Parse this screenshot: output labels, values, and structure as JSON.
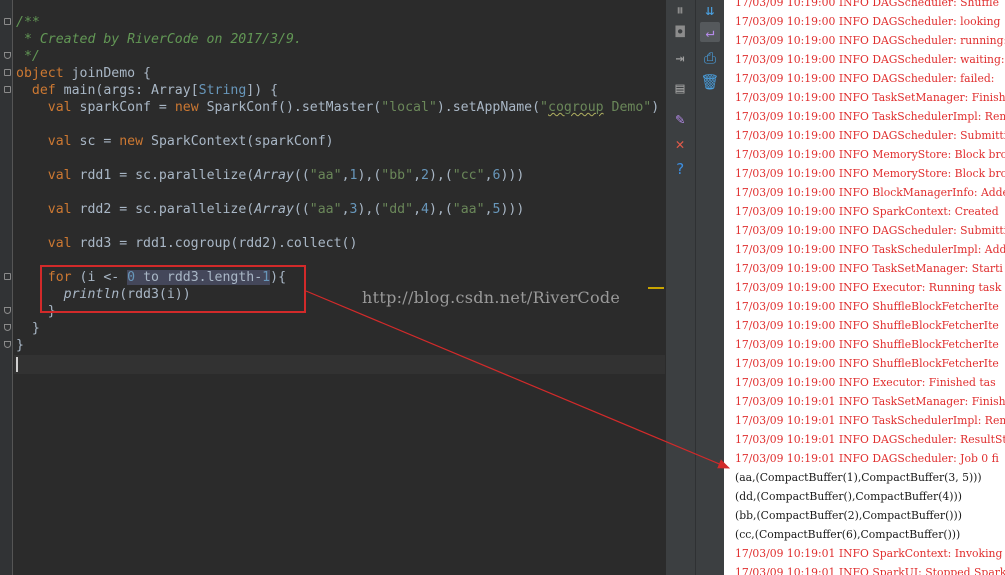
{
  "editor": {
    "lines": [
      [
        {
          "t": "/**",
          "c": "cmt"
        }
      ],
      [
        {
          "t": " * Created by RiverCode on 2017/3/9.",
          "c": "cmt"
        }
      ],
      [
        {
          "t": " */",
          "c": "cmt"
        }
      ],
      [
        {
          "t": "object ",
          "c": "kw"
        },
        {
          "t": "joinDemo {",
          "c": ""
        }
      ],
      [
        {
          "t": "  "
        },
        {
          "t": "def ",
          "c": "kw"
        },
        {
          "t": "main(args: Array["
        },
        {
          "t": "String",
          "c": "num"
        },
        {
          "t": "]) {"
        }
      ],
      [
        {
          "t": "    "
        },
        {
          "t": "val ",
          "c": "kw"
        },
        {
          "t": "sparkConf = "
        },
        {
          "t": "new ",
          "c": "kw"
        },
        {
          "t": "SparkConf().setMaster("
        },
        {
          "t": "\"local\"",
          "c": "str"
        },
        {
          "t": ").setAppName("
        },
        {
          "t": "\"",
          "c": "str"
        },
        {
          "t": "cogroup",
          "c": "str squig"
        },
        {
          "t": " Demo\"",
          "c": "str"
        },
        {
          "t": ")"
        }
      ],
      [
        {
          "t": ""
        }
      ],
      [
        {
          "t": "    "
        },
        {
          "t": "val ",
          "c": "kw"
        },
        {
          "t": "sc = "
        },
        {
          "t": "new ",
          "c": "kw"
        },
        {
          "t": "SparkContext(sparkConf)"
        }
      ],
      [
        {
          "t": ""
        }
      ],
      [
        {
          "t": "    "
        },
        {
          "t": "val ",
          "c": "kw"
        },
        {
          "t": "rdd1 = sc.parallelize("
        },
        {
          "t": "Array",
          "c": "ital"
        },
        {
          "t": "(("
        },
        {
          "t": "\"aa\"",
          "c": "str"
        },
        {
          "t": ","
        },
        {
          "t": "1",
          "c": "num"
        },
        {
          "t": "),("
        },
        {
          "t": "\"bb\"",
          "c": "str"
        },
        {
          "t": ","
        },
        {
          "t": "2",
          "c": "num"
        },
        {
          "t": "),("
        },
        {
          "t": "\"cc\"",
          "c": "str"
        },
        {
          "t": ","
        },
        {
          "t": "6",
          "c": "num"
        },
        {
          "t": ")))"
        }
      ],
      [
        {
          "t": ""
        }
      ],
      [
        {
          "t": "    "
        },
        {
          "t": "val ",
          "c": "kw"
        },
        {
          "t": "rdd2 = sc.parallelize("
        },
        {
          "t": "Array",
          "c": "ital"
        },
        {
          "t": "(("
        },
        {
          "t": "\"aa\"",
          "c": "str"
        },
        {
          "t": ","
        },
        {
          "t": "3",
          "c": "num"
        },
        {
          "t": "),("
        },
        {
          "t": "\"dd\"",
          "c": "str"
        },
        {
          "t": ","
        },
        {
          "t": "4",
          "c": "num"
        },
        {
          "t": "),("
        },
        {
          "t": "\"aa\"",
          "c": "str"
        },
        {
          "t": ","
        },
        {
          "t": "5",
          "c": "num"
        },
        {
          "t": ")))"
        }
      ],
      [
        {
          "t": ""
        }
      ],
      [
        {
          "t": "    "
        },
        {
          "t": "val ",
          "c": "kw"
        },
        {
          "t": "rdd3 = rdd1.cogroup(rdd2).collect()"
        }
      ],
      [
        {
          "t": ""
        }
      ],
      [
        {
          "t": "    "
        },
        {
          "t": "for ",
          "c": "kw"
        },
        {
          "t": "(i <- "
        },
        {
          "t": "0",
          "c": "num sel"
        },
        {
          "t": " to rdd3.length-",
          "c": "sel"
        },
        {
          "t": "1",
          "c": "num sel"
        },
        {
          "t": "){"
        }
      ],
      [
        {
          "t": "      "
        },
        {
          "t": "println",
          "c": "ital"
        },
        {
          "t": "(rdd3(i))"
        }
      ],
      [
        {
          "t": "    }"
        }
      ],
      [
        {
          "t": "  }"
        }
      ],
      [
        {
          "t": "}"
        }
      ]
    ]
  },
  "watermark": "http://blog.csdn.net/RiverCode",
  "toolbar": {
    "left_icons": [
      {
        "name": "pause-icon",
        "glyph": "⏸",
        "color": "#8c8c8c"
      },
      {
        "name": "camera-icon",
        "glyph": "◘",
        "color": "#8c8c8c"
      },
      {
        "name": "exit-icon",
        "glyph": "⇥",
        "color": "#a0a0a0"
      },
      {
        "name": "layout-icon",
        "glyph": "▤",
        "color": "#a0a0a0"
      },
      {
        "name": "pin-icon",
        "glyph": "✎",
        "color": "#b48ae8"
      },
      {
        "name": "close-icon",
        "glyph": "✕",
        "color": "#e05a4a"
      },
      {
        "name": "help-icon",
        "glyph": "?",
        "color": "#3c8ee0"
      }
    ],
    "right_icons": [
      {
        "name": "scroll-to-end-icon",
        "glyph": "⇊",
        "color": "#4aa0e0"
      },
      {
        "name": "soft-wrap-icon",
        "glyph": "↵",
        "color": "#b48ae8"
      },
      {
        "name": "print-icon",
        "glyph": "⎙",
        "color": "#4aa0e0"
      },
      {
        "name": "trash-icon",
        "glyph": "🗑",
        "color": "#4aa0e0"
      }
    ]
  },
  "console": {
    "lines": [
      {
        "t": "17/03/09 10:19:00 INFO DAGScheduler: Shuffle",
        "k": "err"
      },
      {
        "t": "17/03/09 10:19:00 INFO DAGScheduler: looking",
        "k": "err"
      },
      {
        "t": "17/03/09 10:19:00 INFO DAGScheduler: running:",
        "k": "err"
      },
      {
        "t": "17/03/09 10:19:00 INFO DAGScheduler: waiting:",
        "k": "err"
      },
      {
        "t": "17/03/09 10:19:00 INFO DAGScheduler: failed: ",
        "k": "err"
      },
      {
        "t": "17/03/09 10:19:00 INFO TaskSetManager: Finish",
        "k": "err"
      },
      {
        "t": "17/03/09 10:19:00 INFO TaskSchedulerImpl: Rem",
        "k": "err"
      },
      {
        "t": "17/03/09 10:19:00 INFO DAGScheduler: Submitti",
        "k": "err"
      },
      {
        "t": "17/03/09 10:19:00 INFO MemoryStore: Block bro",
        "k": "err"
      },
      {
        "t": "17/03/09 10:19:00 INFO MemoryStore: Block bro",
        "k": "err"
      },
      {
        "t": "17/03/09 10:19:00 INFO BlockManagerInfo: Adde",
        "k": "err"
      },
      {
        "t": "17/03/09 10:19:00 INFO SparkContext: Created ",
        "k": "err"
      },
      {
        "t": "17/03/09 10:19:00 INFO DAGScheduler: Submitti",
        "k": "err"
      },
      {
        "t": "17/03/09 10:19:00 INFO TaskSchedulerImpl: Add",
        "k": "err"
      },
      {
        "t": "17/03/09 10:19:00 INFO TaskSetManager: Starti",
        "k": "err"
      },
      {
        "t": "17/03/09 10:19:00 INFO Executor: Running task",
        "k": "err"
      },
      {
        "t": "17/03/09 10:19:00 INFO ShuffleBlockFetcherIte",
        "k": "err"
      },
      {
        "t": "17/03/09 10:19:00 INFO ShuffleBlockFetcherIte",
        "k": "err"
      },
      {
        "t": "17/03/09 10:19:00 INFO ShuffleBlockFetcherIte",
        "k": "err"
      },
      {
        "t": "17/03/09 10:19:00 INFO ShuffleBlockFetcherIte",
        "k": "err"
      },
      {
        "t": "17/03/09 10:19:00 INFO Executor: Finished tas",
        "k": "err"
      },
      {
        "t": "17/03/09 10:19:01 INFO TaskSetManager: Finish",
        "k": "err"
      },
      {
        "t": "17/03/09 10:19:01 INFO TaskSchedulerImpl: Rem",
        "k": "err"
      },
      {
        "t": "17/03/09 10:19:01 INFO DAGScheduler: ResultSt",
        "k": "err"
      },
      {
        "t": "17/03/09 10:19:01 INFO DAGScheduler: Job 0 fi",
        "k": "err"
      },
      {
        "t": "(aa,(CompactBuffer(1),CompactBuffer(3, 5)))",
        "k": "out"
      },
      {
        "t": "(dd,(CompactBuffer(),CompactBuffer(4)))",
        "k": "out"
      },
      {
        "t": "(bb,(CompactBuffer(2),CompactBuffer()))",
        "k": "out"
      },
      {
        "t": "(cc,(CompactBuffer(6),CompactBuffer()))",
        "k": "out"
      },
      {
        "t": "17/03/09 10:19:01 INFO SparkContext: Invoking",
        "k": "err"
      },
      {
        "t": "17/03/09 10:19:01 INFO SparkUI: Stopped Spark",
        "k": "err"
      }
    ]
  },
  "colors": {
    "annotation_red": "#d22a2a",
    "log_red": "#e02e2e"
  }
}
